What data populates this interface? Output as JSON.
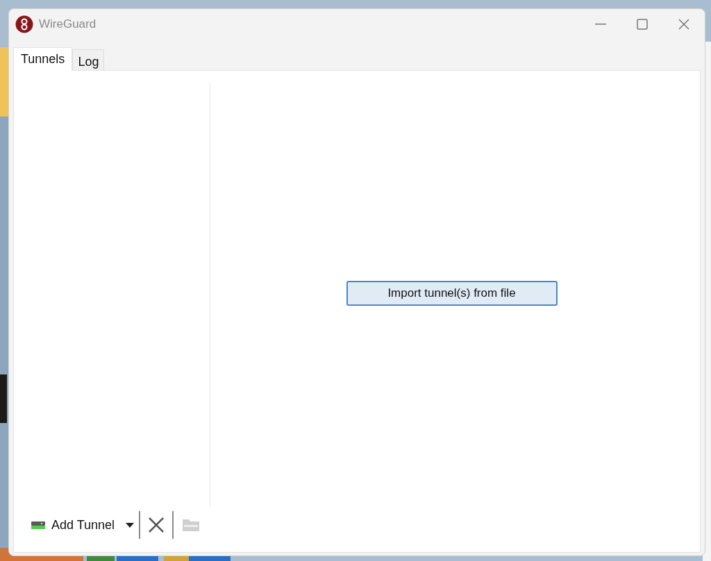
{
  "window": {
    "title": "WireGuard"
  },
  "tabs": [
    {
      "label": "Tunnels",
      "selected": true
    },
    {
      "label": "Log",
      "selected": false
    }
  ],
  "import_button": {
    "label": "Import tunnel(s) from file"
  },
  "toolbar": {
    "add_tunnel": {
      "label": "Add Tunnel"
    }
  }
}
